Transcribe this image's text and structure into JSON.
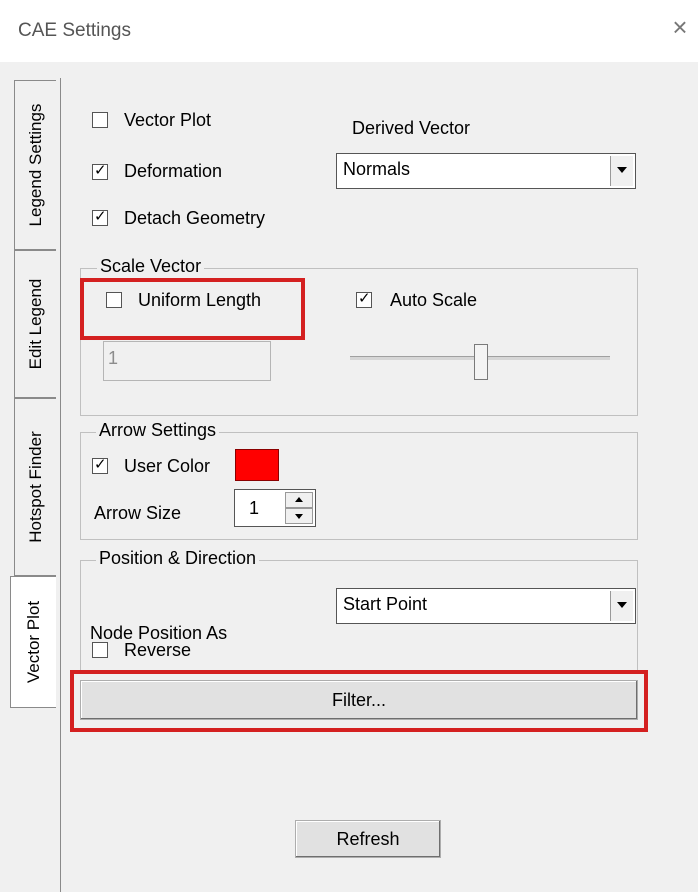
{
  "window": {
    "title": "CAE Settings",
    "close_glyph": "×"
  },
  "tabs": [
    {
      "label": "Legend Settings"
    },
    {
      "label": "Edit Legend"
    },
    {
      "label": "Hotspot Finder"
    },
    {
      "label": "Vector Plot"
    }
  ],
  "options": {
    "vector_plot": {
      "label": "Vector Plot",
      "checked": false
    },
    "deformation": {
      "label": "Deformation",
      "checked": true
    },
    "detach_geometry": {
      "label": "Detach Geometry",
      "checked": true
    }
  },
  "derived_vector": {
    "label": "Derived Vector",
    "value": "Normals"
  },
  "scale_vector": {
    "title": "Scale Vector",
    "uniform_length": {
      "label": "Uniform Length",
      "checked": false
    },
    "auto_scale": {
      "label": "Auto Scale",
      "checked": true
    },
    "length_value": "1",
    "slider_level": 0.5
  },
  "arrow_settings": {
    "title": "Arrow Settings",
    "user_color": {
      "label": "User Color",
      "checked": true,
      "color": "#ff0000"
    },
    "arrow_size_label": "Arrow Size",
    "arrow_size_value": "1"
  },
  "position_direction": {
    "title": "Position & Direction",
    "node_position_label": "Node Position As",
    "node_position_value": "Start Point",
    "reverse": {
      "label": "Reverse",
      "checked": false
    }
  },
  "buttons": {
    "filter": "Filter...",
    "refresh": "Refresh"
  },
  "check_glyph": "✓",
  "highlight_color": "#d42020"
}
